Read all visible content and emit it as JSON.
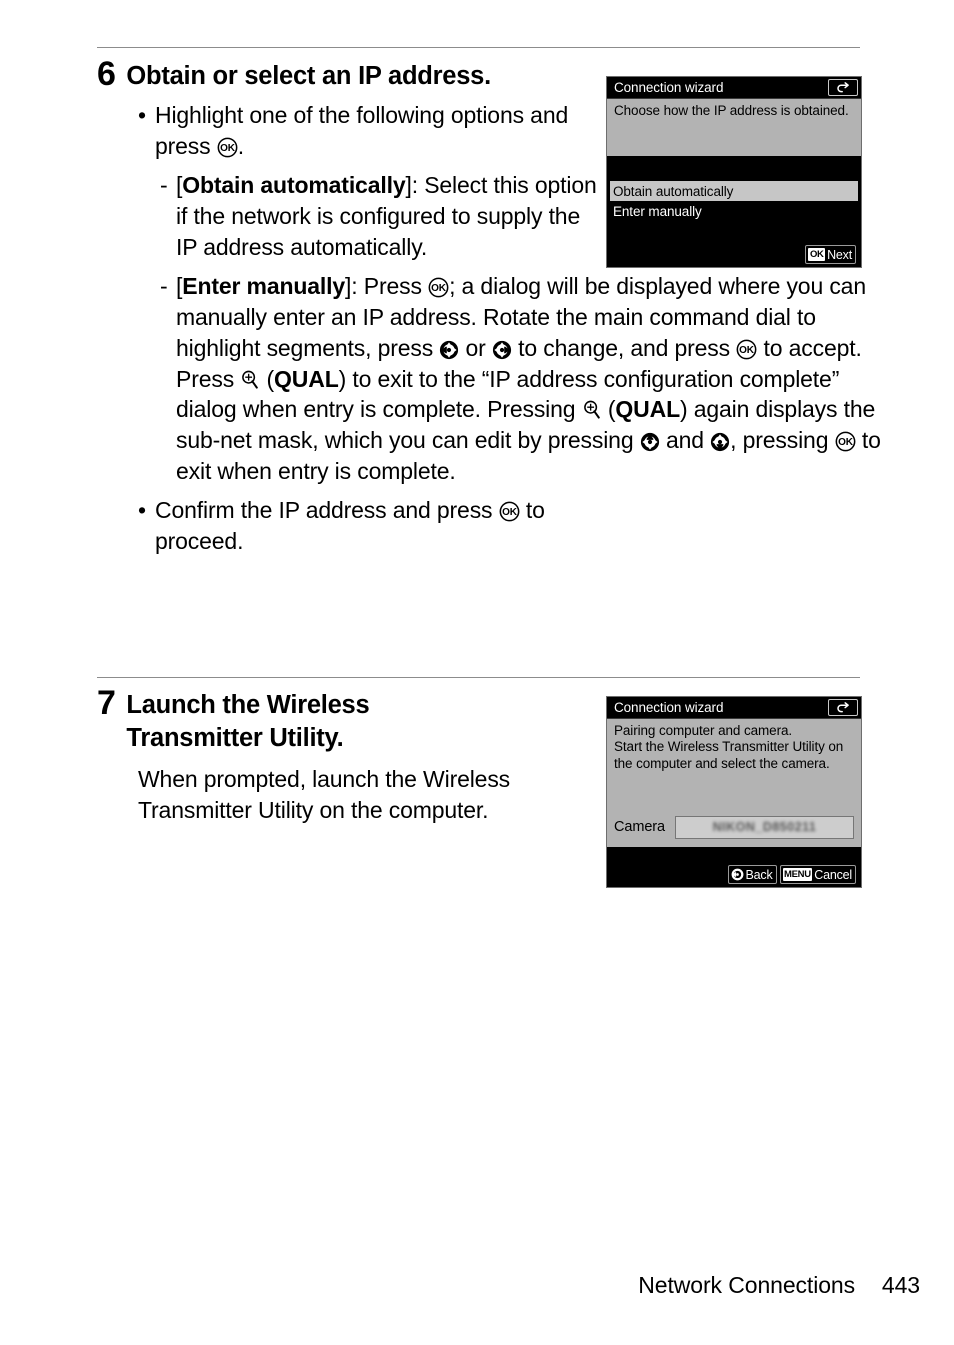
{
  "page": {
    "footer_section": "Network Connections",
    "page_number": "443"
  },
  "steps": [
    {
      "number": "6",
      "title": "Obtain or select an IP address.",
      "bullet1_a": "Highlight one of the following options and press ",
      "bullet1_b": ".",
      "sub1_bracket_open": "[",
      "sub1_bold": "Obtain automatically",
      "sub1_text": "]: Select this option if the network is configured to supply the IP address automatically.",
      "sub2_bracket_open": "[",
      "sub2_bold": "Enter manually",
      "sub2_t1": "]: Press ",
      "sub2_t2": "; a dialog will be displayed where you can manually enter an IP address. Rotate the main command dial to highlight segments, press ",
      "sub2_t3": " or ",
      "sub2_t4": " to change, and press ",
      "sub2_t5": " to accept. Press ",
      "sub2_t6": " (",
      "sub2_qual1": "QUAL",
      "sub2_t7": ") to exit to the “IP address configuration complete” dialog when entry is complete. Pressing ",
      "sub2_t8": " (",
      "sub2_qual2": "QUAL",
      "sub2_t9": ") again displays the sub-net mask, which you can edit by pressing ",
      "sub2_t10": " and ",
      "sub2_t11": ", pressing ",
      "sub2_t12": " to exit when entry is complete.",
      "bullet2_a": "Confirm the IP address and press ",
      "bullet2_b": " to proceed."
    },
    {
      "number": "7",
      "title": "Launch the Wireless Transmitter Utility.",
      "body": "When prompted, launch the Wireless Transmitter Utility on the computer."
    }
  ],
  "screenshots": {
    "ip_address": {
      "title": "Connection wizard",
      "prompt": "Choose how the IP address is obtained.",
      "options": [
        {
          "label": "Obtain automatically",
          "selected": true
        },
        {
          "label": "Enter manually",
          "selected": false
        }
      ],
      "footer": [
        {
          "key": "OK",
          "key_type": "badge",
          "label": "Next"
        }
      ]
    },
    "pairing": {
      "title": "Connection wizard",
      "prompt_line1": "Pairing computer and camera.",
      "prompt_line2": "Start the Wireless Transmitter Utility on",
      "prompt_line3": "the computer and select the camera.",
      "camera_label": "Camera",
      "camera_value": "NIKON_D850211",
      "footer": [
        {
          "key": "multi-selector-left",
          "key_type": "glyph",
          "label": "Back"
        },
        {
          "key": "MENU",
          "key_type": "badge",
          "label": "Cancel"
        }
      ]
    }
  },
  "icons": {
    "ok_button": "ok-button-icon",
    "multi_selector_left": "multi-selector-left-icon",
    "multi_selector_right": "multi-selector-right-icon",
    "multi_selector_up": "multi-selector-up-icon",
    "multi_selector_down": "multi-selector-down-icon",
    "qual_button": "qual-zoom-in-button-icon",
    "return_arrow": "return-arrow-icon"
  },
  "colors": {
    "page_background": "#ffffff",
    "text": "#000000",
    "rule": "#8c8c8c",
    "monitor_black": "#000000",
    "monitor_gray": "#b3b3b3",
    "highlight": "#c6c6c6"
  }
}
